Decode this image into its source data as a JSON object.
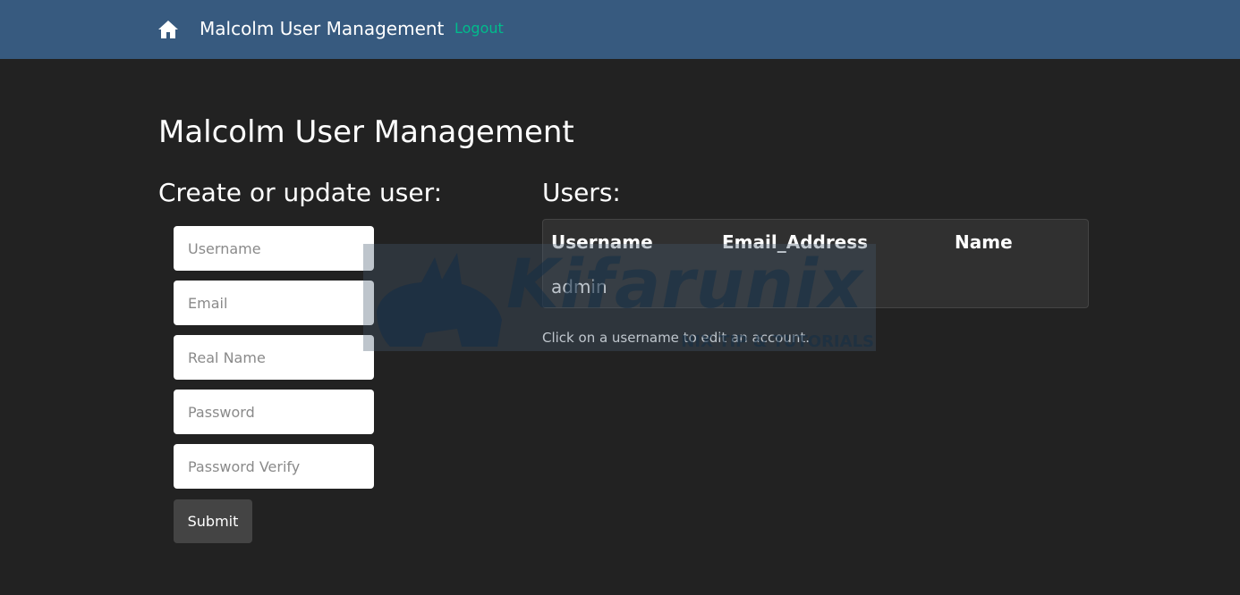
{
  "navbar": {
    "home_icon": "home-icon",
    "brand": "Malcolm User Management",
    "logout": "Logout",
    "background_color": "#375a7f",
    "logout_color": "#00bc8c"
  },
  "page": {
    "title": "Malcolm User Management",
    "background_color": "#222222"
  },
  "create_form": {
    "heading": "Create or update user:",
    "username_placeholder": "Username",
    "email_placeholder": "Email",
    "realname_placeholder": "Real Name",
    "password_placeholder": "Password",
    "password_verify_placeholder": "Password Verify",
    "submit_label": "Submit"
  },
  "users_panel": {
    "heading": "Users:",
    "columns": [
      "Username",
      "Email_Address",
      "Name"
    ],
    "rows": [
      {
        "username": "admin",
        "email": "",
        "name": ""
      }
    ],
    "help_text": "Click on a username to edit an account."
  },
  "watermark": {
    "text": "Kifarunix",
    "subtext": "NIX TIP & TUTORIALS"
  }
}
